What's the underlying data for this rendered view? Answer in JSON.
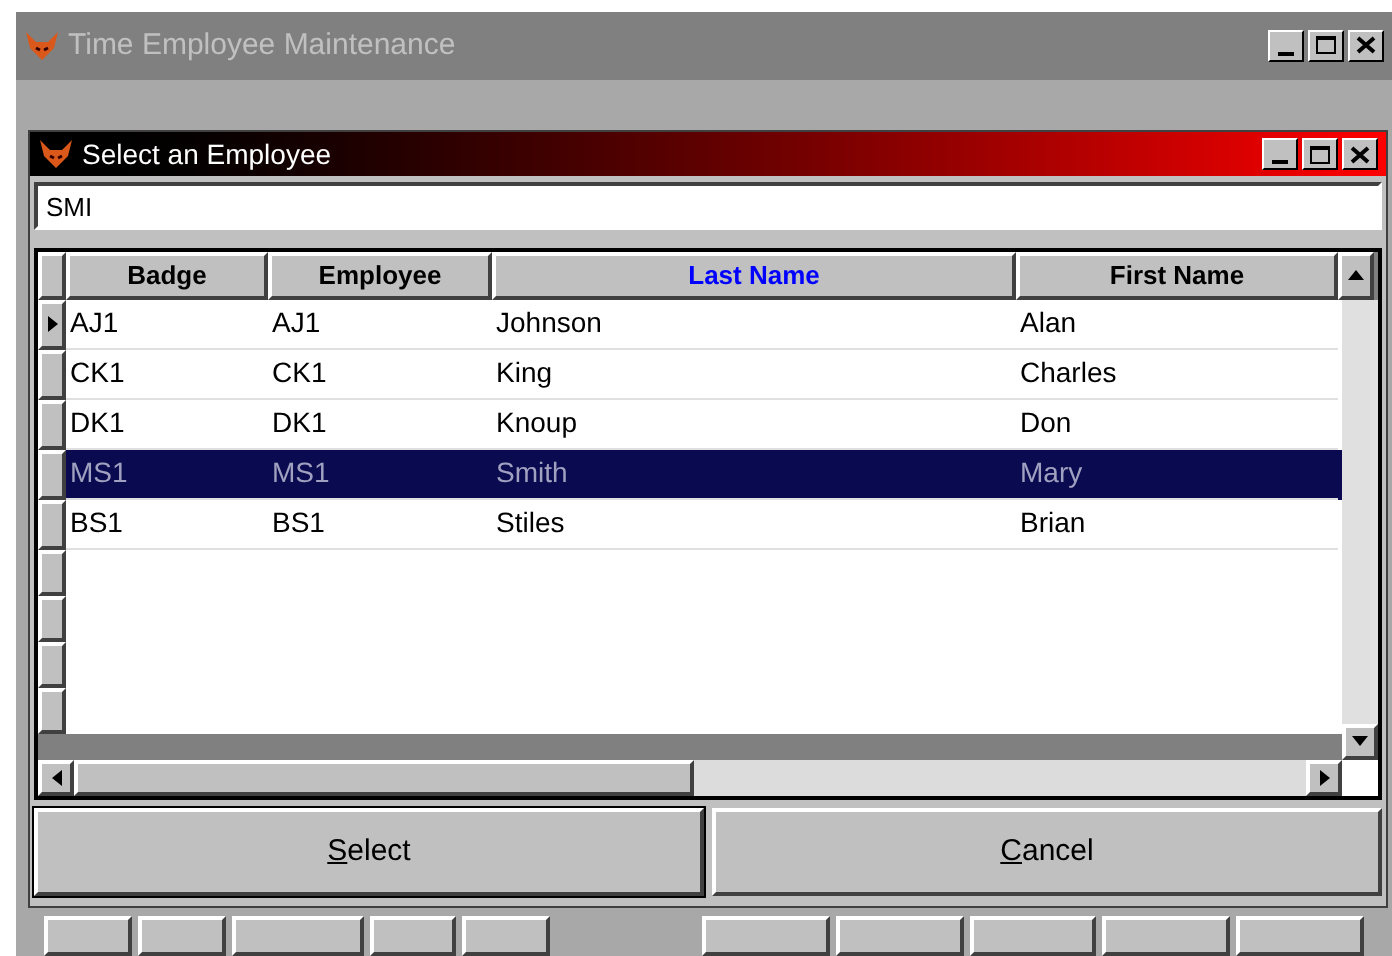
{
  "window": {
    "title": "Time Employee Maintenance"
  },
  "dialog": {
    "title": "Select an Employee",
    "search": {
      "value": "SMI"
    },
    "table": {
      "columns": [
        {
          "label": "Badge",
          "sorted": false
        },
        {
          "label": "Employee",
          "sorted": false
        },
        {
          "label": "Last Name",
          "sorted": true
        },
        {
          "label": "First Name",
          "sorted": false
        }
      ],
      "rows": [
        {
          "cells": [
            "AJ1",
            "AJ1",
            "Johnson",
            "Alan"
          ],
          "current": true,
          "selected": false
        },
        {
          "cells": [
            "CK1",
            "CK1",
            "King",
            "Charles"
          ],
          "current": false,
          "selected": false
        },
        {
          "cells": [
            "DK1",
            "DK1",
            "Knoup",
            "Don"
          ],
          "current": false,
          "selected": false
        },
        {
          "cells": [
            "MS1",
            "MS1",
            "Smith",
            "Mary"
          ],
          "current": false,
          "selected": true
        },
        {
          "cells": [
            "BS1",
            "BS1",
            "Stiles",
            "Brian"
          ],
          "current": false,
          "selected": false
        }
      ]
    },
    "buttons": [
      {
        "label": "Select",
        "kind": "default"
      },
      {
        "label": "Cancel",
        "kind": "normal"
      }
    ]
  }
}
